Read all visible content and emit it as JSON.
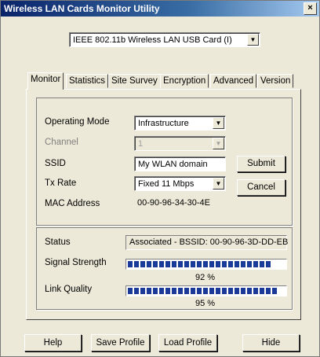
{
  "window": {
    "title": "Wireless LAN Cards Monitor Utility",
    "close_glyph": "×"
  },
  "adapter": {
    "selected": "IEEE 802.11b Wireless LAN USB Card (I)"
  },
  "tabs": [
    {
      "label": "Monitor",
      "active": true
    },
    {
      "label": "Statistics"
    },
    {
      "label": "Site Survey"
    },
    {
      "label": "Encryption"
    },
    {
      "label": "Advanced"
    },
    {
      "label": "Version"
    }
  ],
  "settings": {
    "operating_mode": {
      "label": "Operating Mode",
      "value": "Infrastructure"
    },
    "channel": {
      "label": "Channel",
      "value": "1"
    },
    "ssid": {
      "label": "SSID",
      "value": "My WLAN domain"
    },
    "tx_rate": {
      "label": "Tx Rate",
      "value": "Fixed 11 Mbps"
    },
    "mac_address": {
      "label": "MAC Address",
      "value": "00-90-96-34-30-4E"
    },
    "submit_label": "Submit",
    "cancel_label": "Cancel"
  },
  "status": {
    "status": {
      "label": "Status",
      "value": "Associated - BSSID: 00-90-96-3D-DD-EB"
    },
    "signal_strength": {
      "label": "Signal Strength",
      "percent": 92,
      "text": "92 %"
    },
    "link_quality": {
      "label": "Link Quality",
      "percent": 95,
      "text": "95 %"
    }
  },
  "footer": {
    "help_label": "Help",
    "save_profile_label": "Save Profile",
    "load_profile_label": "Load Profile",
    "hide_label": "Hide"
  },
  "colors": {
    "title_bar": "#0a246a",
    "progress_fill": "#1a3a9a",
    "window_bg": "#ece9d8"
  }
}
